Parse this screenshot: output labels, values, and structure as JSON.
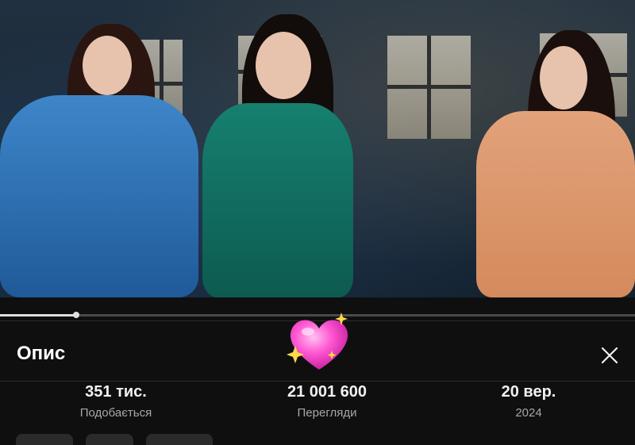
{
  "video": {
    "progress_fraction": 0.12
  },
  "description_panel": {
    "title": "Опис",
    "close_icon": "close-icon",
    "stats": [
      {
        "value": "351 тис.",
        "label": "Подобається"
      },
      {
        "value": "21 001 600",
        "label": "Перегляди"
      },
      {
        "value": "20 вер.",
        "label": "2024"
      }
    ]
  },
  "sticker": {
    "icon": "sparkling-heart-icon",
    "color": "#ff4fc8"
  },
  "colors": {
    "background": "#0f0f0f",
    "text_primary": "#f1f1f1",
    "text_secondary": "#a8a8a8",
    "progress": "#e0e0e0"
  }
}
